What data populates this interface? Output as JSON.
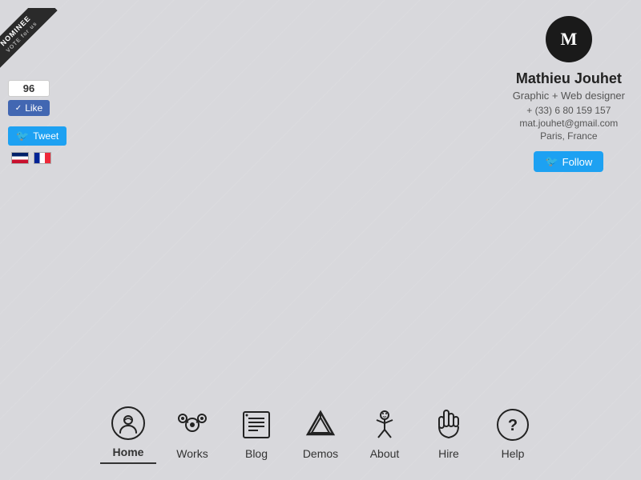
{
  "badge": {
    "nominee_text": "NOMINEE",
    "vote_text": "VOTE for us"
  },
  "like": {
    "count": "96",
    "label": "Like"
  },
  "tweet": {
    "label": "Tweet"
  },
  "flags": [
    {
      "code": "en",
      "label": "English"
    },
    {
      "code": "fr",
      "label": "French"
    }
  ],
  "profile": {
    "initials": "M",
    "name": "Mathieu Jouhet",
    "title": "Graphic + Web designer",
    "phone": "+ (33) 6 80 159 157",
    "email": "mat.jouhet@gmail.com",
    "location": "Paris, France"
  },
  "follow": {
    "label": "Follow"
  },
  "nav": {
    "items": [
      {
        "id": "home",
        "label": "Home",
        "active": true
      },
      {
        "id": "works",
        "label": "Works",
        "active": false
      },
      {
        "id": "blog",
        "label": "Blog",
        "active": false
      },
      {
        "id": "demos",
        "label": "Demos",
        "active": false
      },
      {
        "id": "about",
        "label": "About",
        "active": false
      },
      {
        "id": "hire",
        "label": "Hire",
        "active": false
      },
      {
        "id": "help",
        "label": "Help",
        "active": false
      }
    ]
  }
}
